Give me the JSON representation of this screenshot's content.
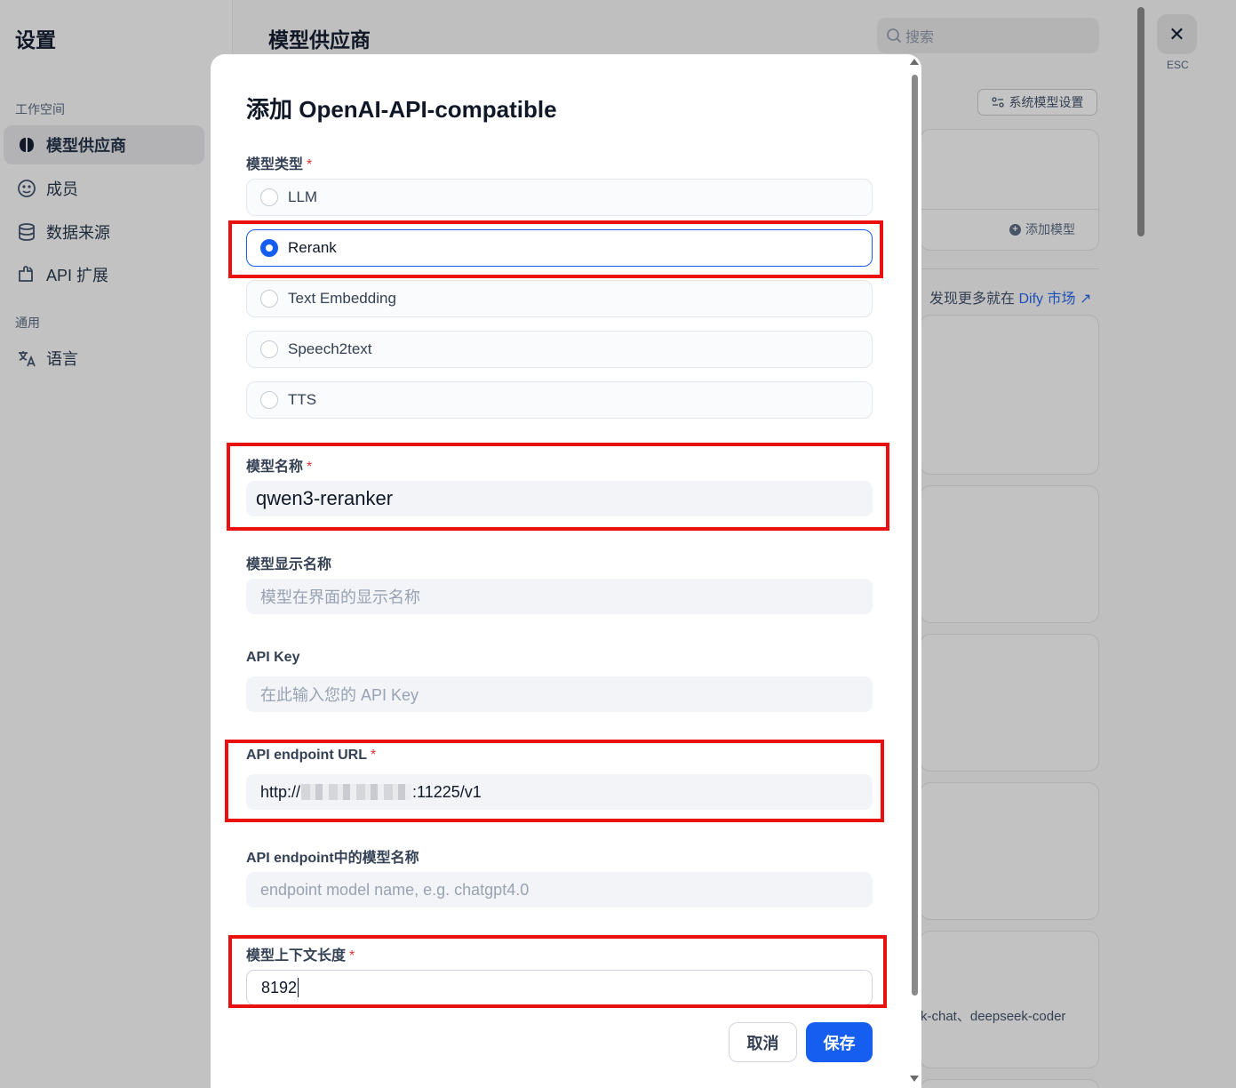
{
  "sidebar": {
    "title": "设置",
    "group_workspace": "工作空间",
    "group_general": "通用",
    "items": [
      {
        "label": "模型供应商",
        "icon": "brain-icon",
        "active": true
      },
      {
        "label": "成员",
        "icon": "members-icon",
        "active": false
      },
      {
        "label": "数据来源",
        "icon": "database-icon",
        "active": false
      },
      {
        "label": "API 扩展",
        "icon": "puzzle-icon",
        "active": false
      },
      {
        "label": "语言",
        "icon": "translate-icon",
        "active": false
      }
    ]
  },
  "main": {
    "title": "模型供应商",
    "search_placeholder": "搜索",
    "system_model_settings": "系统模型设置",
    "add_model": "添加模型",
    "discover_prefix": "发现更多就在",
    "discover_link": "Dify 市场",
    "model_list_text": "k-chat、deepseek-coder"
  },
  "close": {
    "esc_label": "ESC"
  },
  "modal": {
    "title": "添加 OpenAI-API-compatible",
    "model_type": {
      "label": "模型类型",
      "required": "*",
      "options": [
        "LLM",
        "Rerank",
        "Text Embedding",
        "Speech2text",
        "TTS"
      ],
      "selected": "Rerank"
    },
    "model_name": {
      "label": "模型名称",
      "required": "*",
      "value": "qwen3-reranker"
    },
    "display_name": {
      "label": "模型显示名称",
      "placeholder": "模型在界面的显示名称"
    },
    "api_key": {
      "label": "API Key",
      "placeholder": "在此输入您的 API Key"
    },
    "endpoint_url": {
      "label": "API endpoint URL",
      "required": "*",
      "value_prefix": "http://",
      "value_suffix": ":11225/v1"
    },
    "endpoint_model_name": {
      "label": "API endpoint中的模型名称",
      "placeholder": "endpoint model name, e.g. chatgpt4.0"
    },
    "context_length": {
      "label": "模型上下文长度",
      "required": "*",
      "value": "8192"
    },
    "cancel": "取消",
    "save": "保存"
  },
  "colors": {
    "primary": "#155eef",
    "required": "#e5312f",
    "highlight": "#e8110f"
  }
}
